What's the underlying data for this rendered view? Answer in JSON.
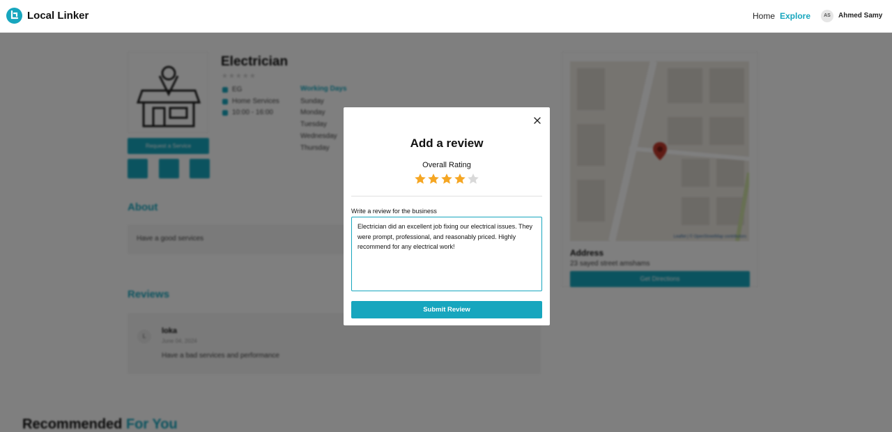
{
  "header": {
    "brand": "Local Linker",
    "nav": {
      "home": "Home",
      "explore": "Explore"
    },
    "user": {
      "initials": "AS",
      "name": "Ahmed Samy"
    }
  },
  "business": {
    "title": "Electrician",
    "price": "EG",
    "category": "Home Services",
    "hours": "10:00 - 16:00",
    "request_button": "Request a Service",
    "working_days_label": "Working Days",
    "working_days": [
      "Sunday",
      "Monday",
      "Tuesday",
      "Wednesday",
      "Thursday"
    ]
  },
  "about": {
    "heading": "About",
    "text": "Have a good services"
  },
  "reviews": {
    "heading": "Reviews",
    "items": [
      {
        "initial": "L",
        "name": "loka",
        "date": "June 04, 2024",
        "text": "Have a bad services and performance"
      }
    ]
  },
  "location": {
    "address_label": "Address",
    "address": "23 sayed street amshams",
    "directions_button": "Get Directions",
    "attribution": "Leaflet | © OpenStreetMap contributors"
  },
  "recommended": {
    "prefix": "Recommended",
    "highlight": "For You"
  },
  "modal": {
    "title": "Add a review",
    "rating_label": "Overall Rating",
    "rating": 4,
    "rating_max": 5,
    "review_label": "Write a review for the business",
    "review_text": "Electrician did an excellent job fixing our electrical issues. They were prompt, professional, and reasonably priced. Highly recommend for any electrical work!",
    "submit_label": "Submit Review"
  },
  "colors": {
    "accent": "#17a6be",
    "star_filled": "#f5a623",
    "star_empty": "#d9d9d9"
  }
}
